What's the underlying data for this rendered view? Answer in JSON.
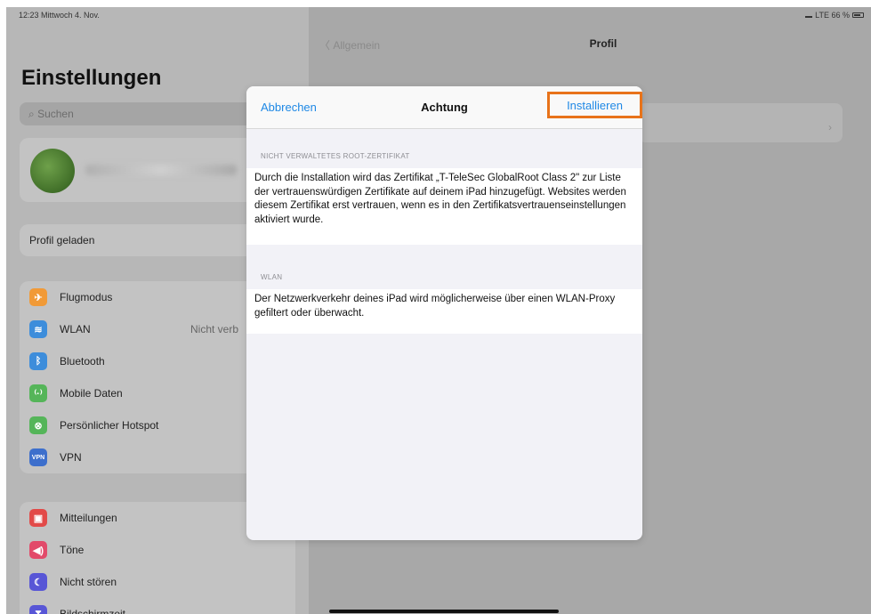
{
  "status_bar": {
    "time": "12:23  Mittwoch 4. Nov.",
    "network": "LTE 66 %"
  },
  "sidebar": {
    "title": "Einstellungen",
    "search_placeholder": "Suchen",
    "profile_loaded": "Profil geladen",
    "group1": [
      {
        "label": "Flugmodus",
        "icon": "airplane-icon",
        "color": "#f19a37",
        "glyph": "✈",
        "value": ""
      },
      {
        "label": "WLAN",
        "icon": "wifi-icon",
        "color": "#3d8ddb",
        "glyph": "≋",
        "value": "Nicht verb"
      },
      {
        "label": "Bluetooth",
        "icon": "bluetooth-icon",
        "color": "#3d8ddb",
        "glyph": "ᛒ",
        "value": ""
      },
      {
        "label": "Mobile Daten",
        "icon": "antenna-icon",
        "color": "#55b559",
        "glyph": "⁽·⁾",
        "value": ""
      },
      {
        "label": "Persönlicher Hotspot",
        "icon": "hotspot-icon",
        "color": "#55b559",
        "glyph": "⊗",
        "value": ""
      },
      {
        "label": "VPN",
        "icon": "vpn-icon",
        "color": "#3d6fcc",
        "glyph": "VPN",
        "value": ""
      }
    ],
    "group2": [
      {
        "label": "Mitteilungen",
        "icon": "notifications-icon",
        "color": "#e24a48",
        "glyph": "▣"
      },
      {
        "label": "Töne",
        "icon": "speaker-icon",
        "color": "#e24a6a",
        "glyph": "◀)"
      },
      {
        "label": "Nicht stören",
        "icon": "moon-icon",
        "color": "#5856d6",
        "glyph": "☾"
      },
      {
        "label": "Bildschirmzeit",
        "icon": "hourglass-icon",
        "color": "#5856d6",
        "glyph": "⧗"
      }
    ]
  },
  "detail": {
    "back_label": "Allgemein",
    "title": "Profil"
  },
  "modal": {
    "cancel": "Abbrechen",
    "title": "Achtung",
    "install": "Installieren",
    "section1_label": "NICHT VERWALTETES ROOT-ZERTIFIKAT",
    "section1_text": "Durch die Installation wird das Zertifikat „T-TeleSec GlobalRoot Class 2\" zur Liste der vertrauenswürdigen Zertifikate auf deinem iPad hinzugefügt. Websites werden diesem Zertifikat erst vertrauen, wenn es in den Zertifikatsvertrauenseinstellungen aktiviert wurde.",
    "section2_label": "WLAN",
    "section2_text": "Der Netzwerkverkehr deines iPad wird möglicherweise über einen WLAN-Proxy gefiltert oder überwacht."
  },
  "colors": {
    "accent": "#1e88e5",
    "highlight": "#e8731a"
  }
}
